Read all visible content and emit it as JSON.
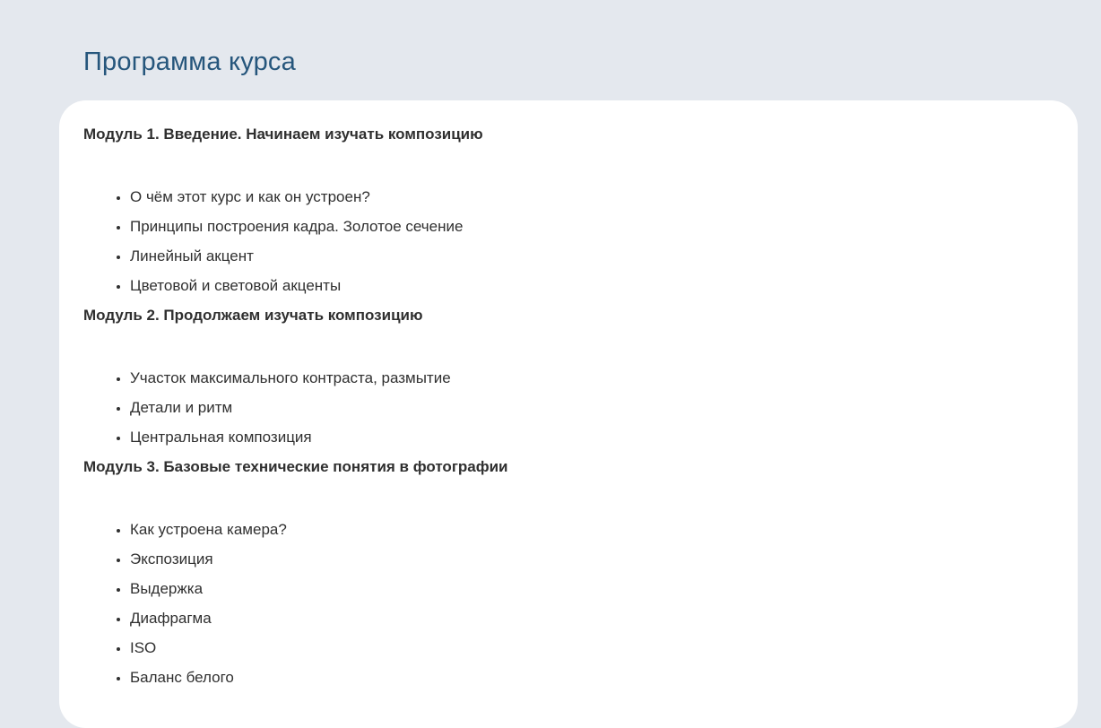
{
  "page": {
    "title": "Программа курса"
  },
  "colors": {
    "background": "#e4e8ee",
    "card": "#ffffff",
    "title": "#26567c",
    "text": "#303030"
  },
  "modules": [
    {
      "heading": "Модуль 1. Введение. Начинаем изучать композицию",
      "items": [
        "О чём этот курс и как он устроен?",
        "Принципы построения кадра. Золотое сечение",
        "Линейный акцент",
        "Цветовой и световой акценты"
      ]
    },
    {
      "heading": "Модуль 2. Продолжаем изучать композицию",
      "items": [
        "Участок максимального контраста, размытие",
        "Детали и ритм",
        "Центральная композиция"
      ]
    },
    {
      "heading": "Модуль 3. Базовые технические понятия в фотографии",
      "items": [
        "Как устроена камера?",
        "Экспозиция",
        "Выдержка",
        "Диафрагма",
        "ISO",
        "Баланс белого"
      ]
    }
  ]
}
